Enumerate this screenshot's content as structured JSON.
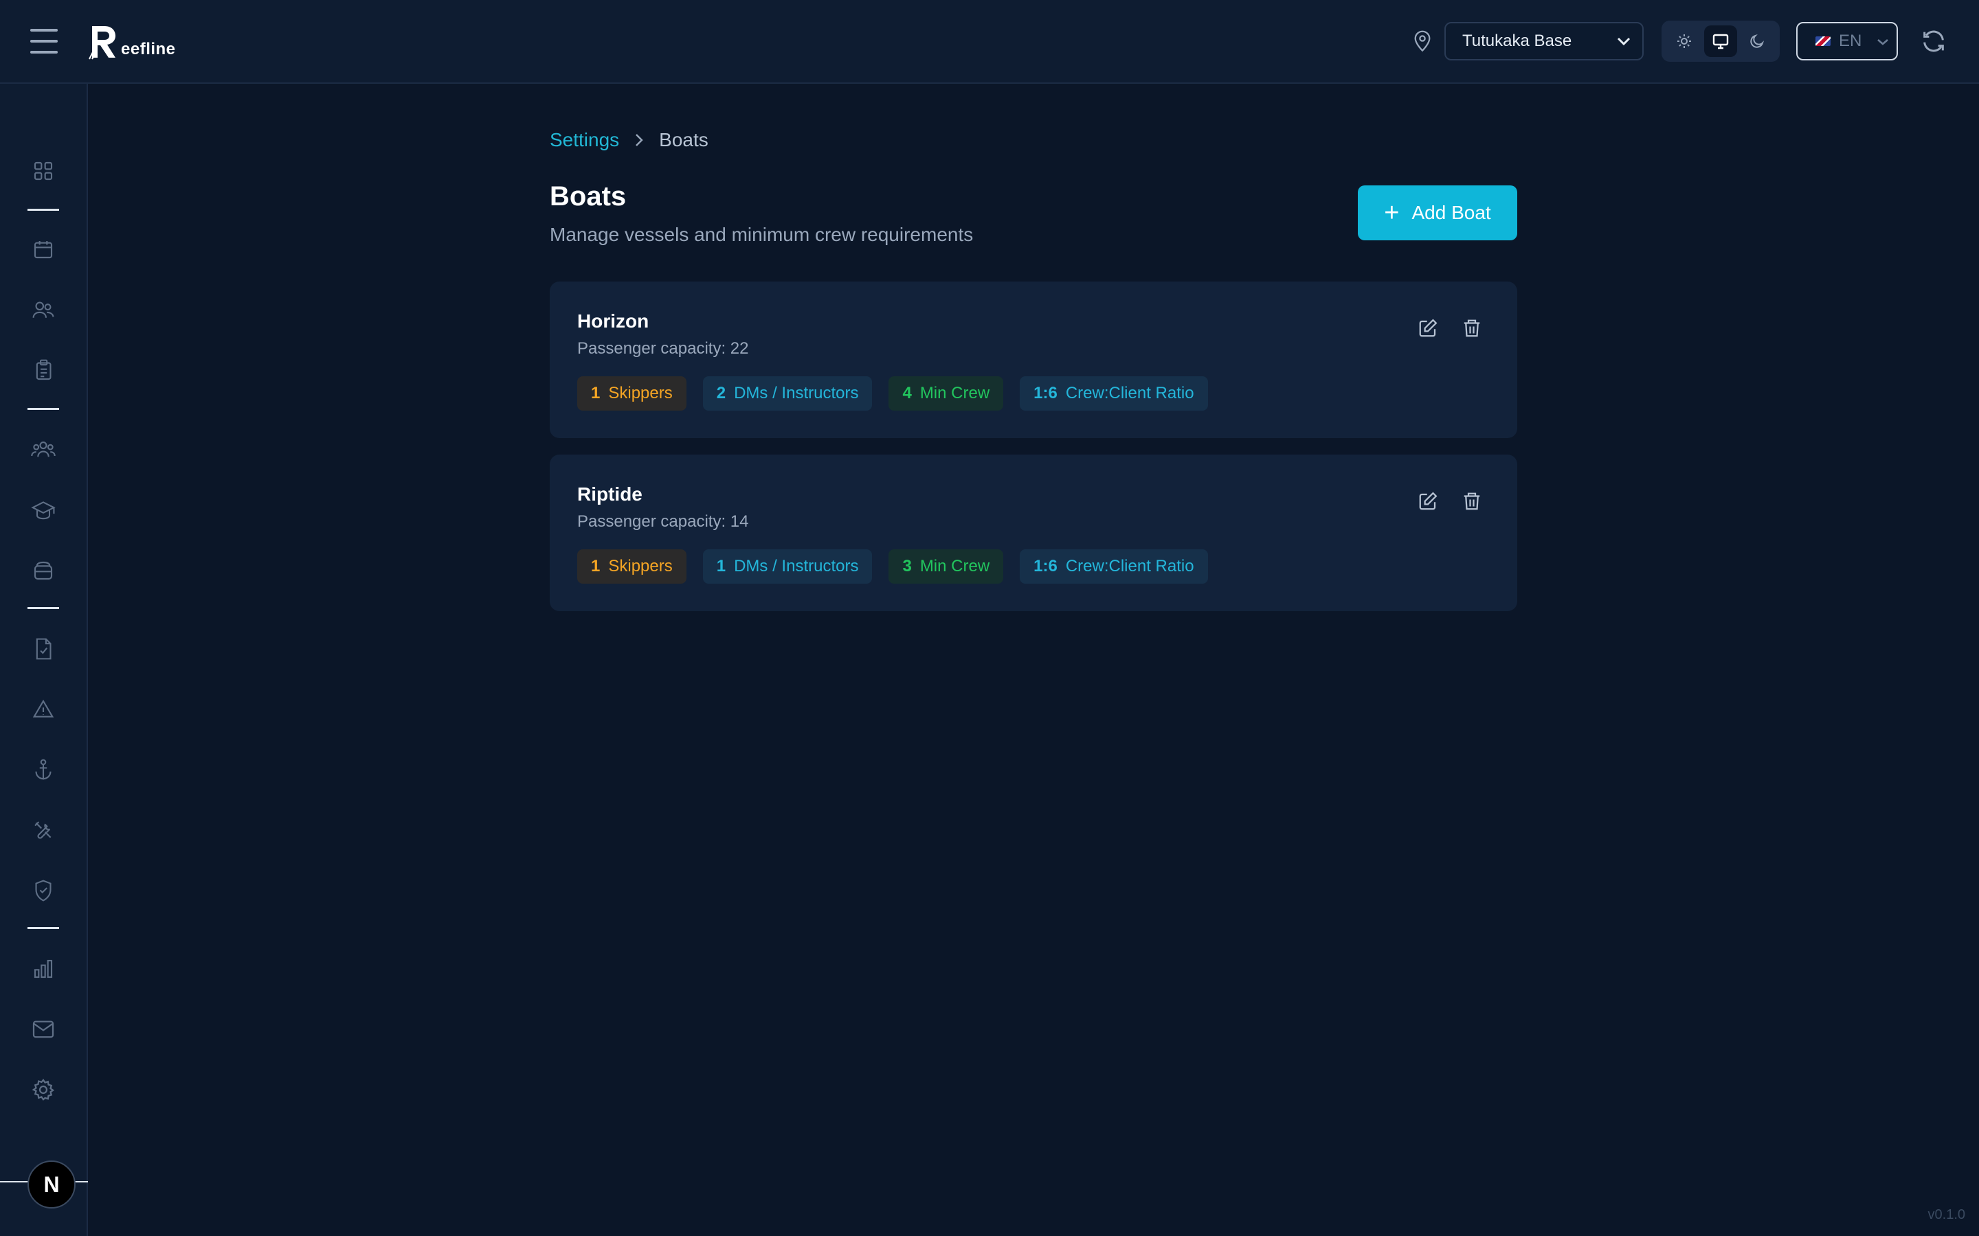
{
  "header": {
    "logo_text": "eefline",
    "base_select": {
      "value": "Tutukaka Base"
    },
    "language_select": {
      "value": "EN"
    }
  },
  "breadcrumb": {
    "parent": "Settings",
    "current": "Boats"
  },
  "page": {
    "title": "Boats",
    "subtitle": "Manage vessels and minimum crew requirements",
    "add_button_label": "Add Boat"
  },
  "boats": [
    {
      "name": "Horizon",
      "capacity": "Passenger capacity: 22",
      "badges": [
        {
          "value": "1",
          "label": "Skippers",
          "color": "#f5a524"
        },
        {
          "value": "2",
          "label": "DMs / Instructors",
          "color": "#24b6da"
        },
        {
          "value": "4",
          "label": "Min Crew",
          "color": "#22c55e"
        },
        {
          "value": "1:6",
          "label": "Crew:Client Ratio",
          "color": "#24b6da"
        }
      ]
    },
    {
      "name": "Riptide",
      "capacity": "Passenger capacity: 14",
      "badges": [
        {
          "value": "1",
          "label": "Skippers",
          "color": "#f5a524"
        },
        {
          "value": "1",
          "label": "DMs / Instructors",
          "color": "#24b6da"
        },
        {
          "value": "3",
          "label": "Min Crew",
          "color": "#22c55e"
        },
        {
          "value": "1:6",
          "label": "Crew:Client Ratio",
          "color": "#24b6da"
        }
      ]
    }
  ],
  "sidebar": {
    "icons": [
      "dashboard-icon",
      "calendar-icon",
      "users-icon",
      "clipboard-icon",
      "group-icon",
      "graduation-cap-icon",
      "briefcase-icon",
      "file-check-icon",
      "alert-triangle-icon",
      "anchor-icon",
      "tools-icon",
      "shield-check-icon",
      "bar-chart-icon",
      "mail-icon",
      "gear-icon"
    ]
  },
  "user": {
    "avatar_initial": "N"
  },
  "footer": {
    "version": "v0.1.0"
  },
  "colors": {
    "accent": "#0fb6d9",
    "background": "#0b1628",
    "card": "#12223a"
  }
}
